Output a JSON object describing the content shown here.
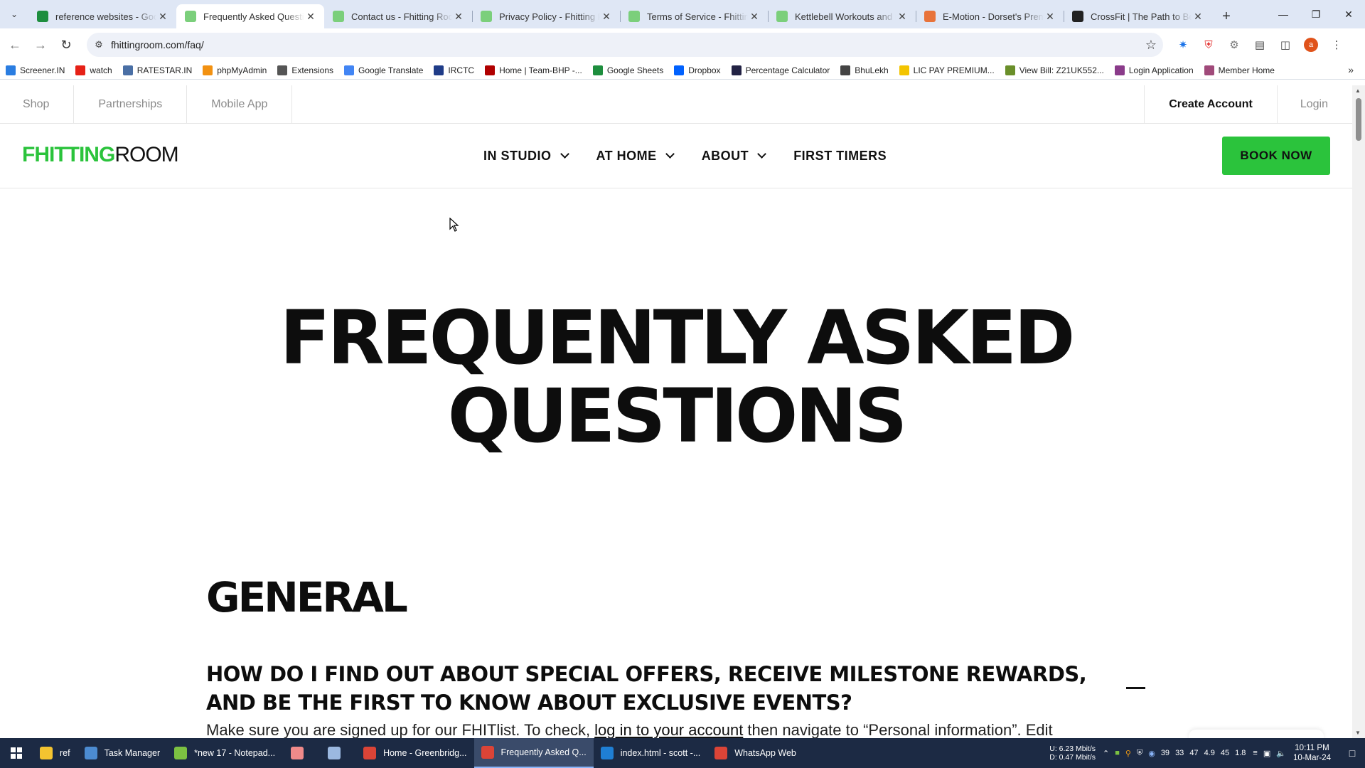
{
  "browser": {
    "tabs": [
      {
        "title": "reference websites - Goog",
        "favicon_color": "#1e8e3e",
        "favicon": "sheets-icon",
        "active": false
      },
      {
        "title": "Frequently Asked Questio",
        "favicon_color": "#7bcf7b",
        "favicon": "fhitting-room-icon",
        "active": true
      },
      {
        "title": "Contact us - Fhitting Roor",
        "favicon_color": "#7bcf7b",
        "favicon": "fhitting-room-icon",
        "active": false
      },
      {
        "title": "Privacy Policy - Fhitting R",
        "favicon_color": "#7bcf7b",
        "favicon": "fhitting-room-icon",
        "active": false
      },
      {
        "title": "Terms of Service - Fhitting",
        "favicon_color": "#7bcf7b",
        "favicon": "fhitting-room-icon",
        "active": false
      },
      {
        "title": "Kettlebell Workouts and I",
        "favicon_color": "#7bcf7b",
        "favicon": "fhitting-room-icon",
        "active": false
      },
      {
        "title": "E-Motion - Dorset's Prem",
        "favicon_color": "#e8733a",
        "favicon": "emotion-icon",
        "active": false
      },
      {
        "title": "CrossFit | The Path to Bett",
        "favicon_color": "#222222",
        "favicon": "crossfit-icon",
        "active": false
      }
    ],
    "url": "fhittingroom.com/faq/",
    "bookmarks": [
      {
        "label": "Screener.IN",
        "color": "#2a7de1",
        "icon": "bar-chart-icon"
      },
      {
        "label": "watch",
        "color": "#e62117",
        "icon": "youtube-icon"
      },
      {
        "label": "RATESTAR.IN",
        "color": "#4a6fa5",
        "icon": "ratestar-icon"
      },
      {
        "label": "phpMyAdmin",
        "color": "#f29111",
        "icon": "phpmyadmin-icon"
      },
      {
        "label": "Extensions",
        "color": "#555555",
        "icon": "puzzle-icon"
      },
      {
        "label": "Google Translate",
        "color": "#4285f4",
        "icon": "translate-icon"
      },
      {
        "label": "IRCTC",
        "color": "#1f3c88",
        "icon": "irctc-icon"
      },
      {
        "label": "Home | Team-BHP -...",
        "color": "#b00000",
        "icon": "teambhp-icon"
      },
      {
        "label": "Google Sheets",
        "color": "#1e8e3e",
        "icon": "sheets-icon"
      },
      {
        "label": "Dropbox",
        "color": "#0061fe",
        "icon": "dropbox-icon"
      },
      {
        "label": "Percentage Calculator",
        "color": "#222244",
        "icon": "percent-icon"
      },
      {
        "label": "BhuLekh",
        "color": "#444444",
        "icon": "globe-icon"
      },
      {
        "label": "LIC PAY PREMIUM...",
        "color": "#f3c400",
        "icon": "lic-icon"
      },
      {
        "label": "View Bill: Z21UK552...",
        "color": "#6a8f2a",
        "icon": "bill-icon"
      },
      {
        "label": "Login Application",
        "color": "#8a3b8a",
        "icon": "login-app-icon"
      },
      {
        "label": "Member Home",
        "color": "#a04a7a",
        "icon": "member-icon"
      }
    ],
    "avatar_letter": "a"
  },
  "site": {
    "util_left": [
      "Shop",
      "Partnerships",
      "Mobile App"
    ],
    "create_account": "Create Account",
    "login": "Login",
    "logo_bold": "FHITTING",
    "logo_light": "ROOM",
    "logo_color": "#2bc33c",
    "menu": [
      {
        "label": "IN STUDIO",
        "dropdown": true
      },
      {
        "label": "AT HOME",
        "dropdown": true
      },
      {
        "label": "ABOUT",
        "dropdown": true
      },
      {
        "label": "FIRST TIMERS",
        "dropdown": false
      }
    ],
    "book_now": "BOOK NOW",
    "hero_line1": "FREQUENTLY ASKED",
    "hero_line2": "QUESTIONS",
    "section_title": "GENERAL",
    "question": "HOW DO I FIND OUT ABOUT SPECIAL OFFERS, RECEIVE MILESTONE REWARDS, AND BE THE FIRST TO KNOW ABOUT EXCLUSIVE EVENTS?",
    "answer_before": "Make sure you are signed up for our FHITlist. To check, ",
    "answer_link": "log in to your account",
    "answer_after": " then navigate to “Personal information”. Edit"
  },
  "taskbar": {
    "items": [
      {
        "label": "ref",
        "icon": "folder-icon",
        "color": "#f4c430"
      },
      {
        "label": "Task Manager",
        "icon": "task-manager-icon",
        "color": "#4c8bd1"
      },
      {
        "label": "*new 17 - Notepad...",
        "icon": "notepad-plus-icon",
        "color": "#7cc142"
      },
      {
        "label": "",
        "icon": "app-pig-icon",
        "color": "#f08a8a"
      },
      {
        "label": "",
        "icon": "notepad-icon",
        "color": "#9bb8e0"
      },
      {
        "label": "Home - Greenbridg...",
        "icon": "chrome-icon",
        "color": "#db4437"
      },
      {
        "label": "Frequently Asked Q...",
        "icon": "chrome-icon",
        "color": "#db4437",
        "active": true
      },
      {
        "label": "index.html - scott -...",
        "icon": "vscode-icon",
        "color": "#1f7fd4"
      },
      {
        "label": "WhatsApp Web",
        "icon": "chrome-icon",
        "color": "#db4437"
      }
    ],
    "net_up": "6.23 Mbit/s",
    "net_down": "0.47 Mbit/s",
    "net_up_label": "U:",
    "net_down_label": "D:",
    "tray_values": [
      "39",
      "33",
      "47",
      "4.9",
      "45",
      "1.8"
    ],
    "time": "10:11 PM",
    "date": "10-Mar-24"
  }
}
